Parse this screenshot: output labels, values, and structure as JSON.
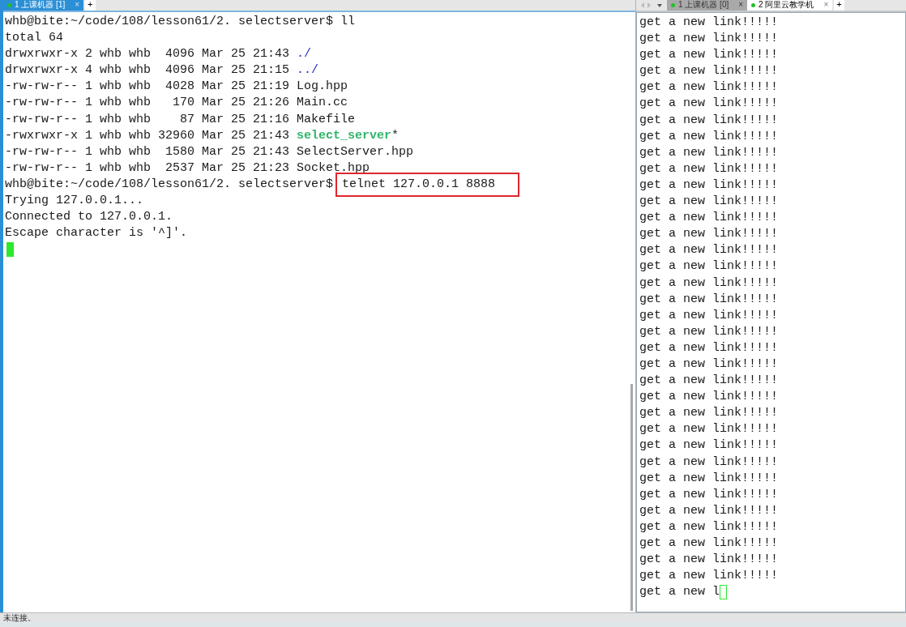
{
  "left_pane": {
    "tabs": [
      {
        "label": "1 上课机器 [1]",
        "selected": true,
        "close": "×"
      }
    ],
    "add_tab": "+",
    "lines": [
      [
        {
          "kind": "plain",
          "text": "whb@bite:~/code/108/lesson61/2. selectserver$ ll"
        }
      ],
      [
        {
          "kind": "plain",
          "text": "total 64"
        }
      ],
      [
        {
          "kind": "plain",
          "text": "drwxrwxr-x 2 whb whb  4096 Mar 25 21:43 "
        },
        {
          "kind": "dir",
          "text": "./"
        }
      ],
      [
        {
          "kind": "plain",
          "text": "drwxrwxr-x 4 whb whb  4096 Mar 25 21:15 "
        },
        {
          "kind": "dir",
          "text": "../"
        }
      ],
      [
        {
          "kind": "plain",
          "text": "-rw-rw-r-- 1 whb whb  4028 Mar 25 21:19 Log.hpp"
        }
      ],
      [
        {
          "kind": "plain",
          "text": "-rw-rw-r-- 1 whb whb   170 Mar 25 21:26 Main.cc"
        }
      ],
      [
        {
          "kind": "plain",
          "text": "-rw-rw-r-- 1 whb whb    87 Mar 25 21:16 Makefile"
        }
      ],
      [
        {
          "kind": "plain",
          "text": "-rwxrwxr-x 1 whb whb 32960 Mar 25 21:43 "
        },
        {
          "kind": "exec",
          "text": "select_server"
        },
        {
          "kind": "plain",
          "text": "*"
        }
      ],
      [
        {
          "kind": "plain",
          "text": "-rw-rw-r-- 1 whb whb  1580 Mar 25 21:43 SelectServer.hpp"
        }
      ],
      [
        {
          "kind": "plain",
          "text": "-rw-rw-r-- 1 whb whb  2537 Mar 25 21:23 Socket.hpp"
        }
      ],
      [
        {
          "kind": "plain",
          "text": "whb@bite:~/code/108/lesson61/2. selectserver$"
        },
        {
          "kind": "boxed",
          "text": "telnet 127.0.0.1 8888"
        }
      ],
      [
        {
          "kind": "plain",
          "text": "Trying 127.0.0.1..."
        }
      ],
      [
        {
          "kind": "plain",
          "text": "Connected to 127.0.0.1."
        }
      ],
      [
        {
          "kind": "plain",
          "text": "Escape character is '^]'."
        }
      ],
      [
        {
          "kind": "cursor"
        }
      ]
    ]
  },
  "right_pane": {
    "tabs": [
      {
        "label": "1 上课机器 [0]",
        "selected": false,
        "close": "×"
      },
      {
        "label": "2 阿里云教学机",
        "selected": true,
        "close": "×"
      }
    ],
    "add_tab": "+",
    "lines": [
      "get a new link!!!!!",
      "get a new link!!!!!",
      "get a new link!!!!!",
      "get a new link!!!!!",
      "get a new link!!!!!",
      "get a new link!!!!!",
      "get a new link!!!!!",
      "get a new link!!!!!",
      "get a new link!!!!!",
      "get a new link!!!!!",
      "get a new link!!!!!",
      "get a new link!!!!!",
      "get a new link!!!!!",
      "get a new link!!!!!",
      "get a new link!!!!!",
      "get a new link!!!!!",
      "get a new link!!!!!",
      "get a new link!!!!!",
      "get a new link!!!!!",
      "get a new link!!!!!",
      "get a new link!!!!!",
      "get a new link!!!!!",
      "get a new link!!!!!",
      "get a new link!!!!!",
      "get a new link!!!!!",
      "get a new link!!!!!",
      "get a new link!!!!!",
      "get a new link!!!!!",
      "get a new link!!!!!",
      "get a new link!!!!!",
      "get a new link!!!!!",
      "get a new link!!!!!",
      "get a new link!!!!!",
      "get a new link!!!!!",
      "get a new link!!!!!"
    ],
    "partial_line": "get a new l"
  },
  "status_bar": {
    "text": "未连接。"
  }
}
